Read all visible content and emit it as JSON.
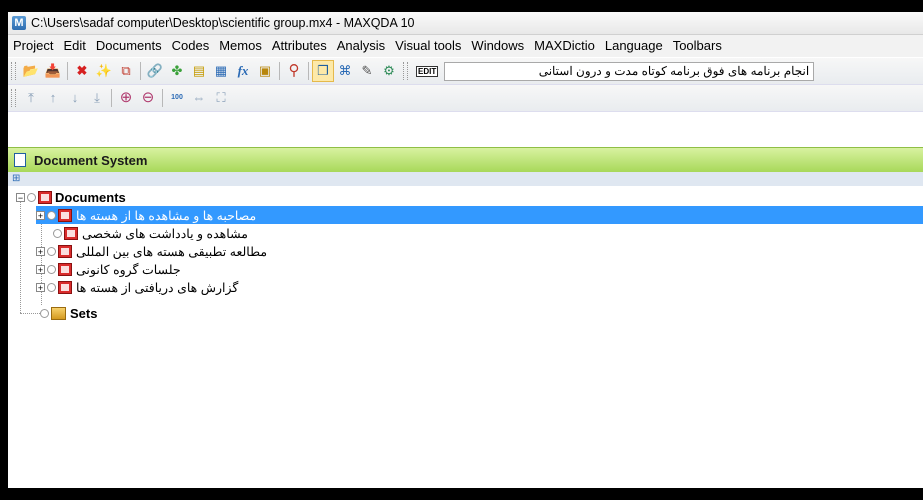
{
  "window": {
    "title": "C:\\Users\\sadaf computer\\Desktop\\scientific group.mx4 - MAXQDA 10",
    "app_icon_letter": "M"
  },
  "menu": [
    "Project",
    "Edit",
    "Documents",
    "Codes",
    "Memos",
    "Attributes",
    "Analysis",
    "Visual tools",
    "Windows",
    "MAXDictio",
    "Language",
    "Toolbars"
  ],
  "toolbar1": {
    "buttons": [
      {
        "icon": "open-folder-icon",
        "glyph": "📂"
      },
      {
        "icon": "import-icon",
        "glyph": "📥"
      },
      {
        "icon": "code-map-icon",
        "glyph": "✖"
      },
      {
        "icon": "wand-icon",
        "glyph": "✨"
      },
      {
        "icon": "copy-icon",
        "glyph": "⧉"
      },
      {
        "icon": "link-icon",
        "glyph": "🔗"
      },
      {
        "icon": "code-relations-icon",
        "glyph": "✤"
      },
      {
        "icon": "memo-icon",
        "glyph": "▤"
      },
      {
        "icon": "table-icon",
        "glyph": "▦"
      },
      {
        "icon": "formula-icon",
        "glyph": "fx"
      },
      {
        "icon": "notebook-icon",
        "glyph": "▣"
      },
      {
        "icon": "search-icon",
        "glyph": "⚲"
      },
      {
        "icon": "document-system-icon",
        "glyph": "❐"
      },
      {
        "icon": "code-system-icon",
        "glyph": "⌘"
      },
      {
        "icon": "edit-memo-icon",
        "glyph": "✎"
      },
      {
        "icon": "settings-icon",
        "glyph": "⚙"
      }
    ],
    "combo_text": "انجام برنامه های فوق برنامه کوتاه مدت و درون استانی",
    "edit_label": "EDIT"
  },
  "toolbar2": {
    "buttons": [
      {
        "icon": "move-top-icon",
        "glyph": "⤒"
      },
      {
        "icon": "move-up-icon",
        "glyph": "↑"
      },
      {
        "icon": "move-down-icon",
        "glyph": "↓"
      },
      {
        "icon": "move-bottom-icon",
        "glyph": "⤓"
      },
      {
        "icon": "zoom-in-icon",
        "glyph": "⊕"
      },
      {
        "icon": "zoom-out-icon",
        "glyph": "⊖"
      },
      {
        "icon": "zoom-100-icon",
        "glyph": "100"
      },
      {
        "icon": "fit-width-icon",
        "glyph": "⇔"
      },
      {
        "icon": "fit-page-icon",
        "glyph": "⛶"
      }
    ]
  },
  "panel": {
    "title": "Document System"
  },
  "tree": {
    "root_label": "Documents",
    "groups": [
      {
        "label": "مصاحبه ها و مشاهده ها از هسته ها",
        "expandable": true,
        "selected": true
      },
      {
        "label": "مشاهده و یادداشت های شخصی",
        "expandable": false,
        "selected": false
      },
      {
        "label": "مطالعه تطبیقی هسته های بین المللی",
        "expandable": true,
        "selected": false
      },
      {
        "label": "جلسات گروه کانونی",
        "expandable": true,
        "selected": false
      },
      {
        "label": "گزارش های دریافتی از هسته ها",
        "expandable": true,
        "selected": false
      }
    ],
    "sets_label": "Sets"
  }
}
